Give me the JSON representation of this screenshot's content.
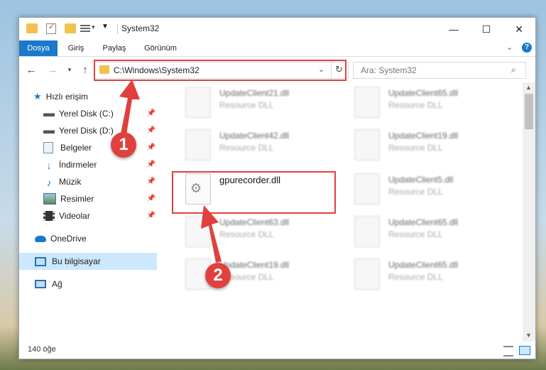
{
  "window": {
    "title": "System32",
    "controls": {
      "minimize": "—",
      "maximize": "☐",
      "close": "✕"
    }
  },
  "ribbon": {
    "tabs": [
      "Dosya",
      "Giriş",
      "Paylaş",
      "Görünüm"
    ]
  },
  "address": {
    "path": "C:\\Windows\\System32",
    "search_placeholder": "Ara: System32"
  },
  "nav": {
    "quick_access": "Hızlı erişim",
    "items": [
      {
        "label": "Yerel Disk (C:)",
        "icon": "drive-icon",
        "pinned": true
      },
      {
        "label": "Yerel Disk (D:)",
        "icon": "drive-icon",
        "pinned": true
      },
      {
        "label": "Belgeler",
        "icon": "documents-icon",
        "pinned": true
      },
      {
        "label": "İndirmeler",
        "icon": "downloads-icon",
        "pinned": true
      },
      {
        "label": "Müzik",
        "icon": "music-icon",
        "pinned": true
      },
      {
        "label": "Resimler",
        "icon": "pictures-icon",
        "pinned": true
      },
      {
        "label": "Videolar",
        "icon": "videos-icon",
        "pinned": true
      }
    ],
    "onedrive": "OneDrive",
    "this_pc": "Bu bilgisayar",
    "network": "Ağ"
  },
  "files": [
    {
      "name": "UpdateClient21.dll",
      "type": "Resource DLL",
      "blurred": true
    },
    {
      "name": "UpdateClient65.dll",
      "type": "Resource DLL",
      "blurred": true
    },
    {
      "name": "UpdateClient42.dll",
      "type": "Resource DLL",
      "blurred": true
    },
    {
      "name": "UpdateClient19.dll",
      "type": "Resource DLL",
      "blurred": true
    },
    {
      "name": "gpurecorder.dll",
      "type": "",
      "blurred": false
    },
    {
      "name": "UpdateClient5.dll",
      "type": "Resource DLL",
      "blurred": true
    },
    {
      "name": "UpdateClient63.dll",
      "type": "Resource DLL",
      "blurred": true
    },
    {
      "name": "UpdateClient65.dll",
      "type": "Resource DLL",
      "blurred": true
    },
    {
      "name": "UpdateClient19.dll",
      "type": "Resource DLL",
      "blurred": true
    },
    {
      "name": "UpdateClient65.dll",
      "type": "Resource DLL",
      "blurred": true
    }
  ],
  "status": {
    "count": "140 öğe"
  },
  "annotations": {
    "step1": "1",
    "step2": "2"
  },
  "colors": {
    "accent": "#1979ca",
    "annotation_red": "#e0403e",
    "selection": "#cce8ff"
  }
}
